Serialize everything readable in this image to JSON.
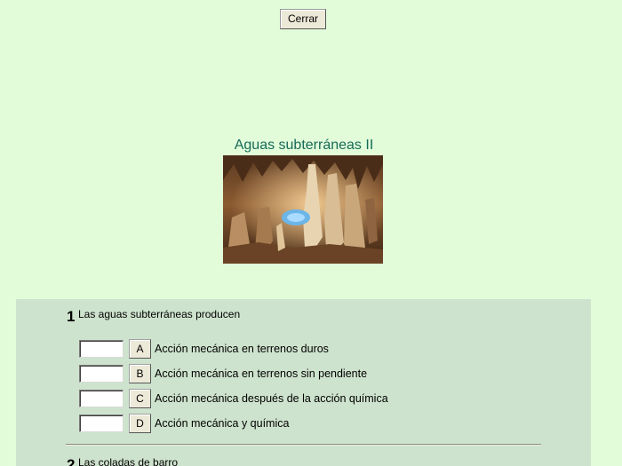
{
  "close_button": {
    "label": "Cerrar"
  },
  "exercise": {
    "title": "Aguas subterráneas II"
  },
  "questions": [
    {
      "number": "1",
      "text": "Las aguas subterráneas producen",
      "options": [
        {
          "letter": "A",
          "text": "Acción mecánica en terrenos duros",
          "answer": ""
        },
        {
          "letter": "B",
          "text": "Acción mecánica en terrenos sin pendiente",
          "answer": ""
        },
        {
          "letter": "C",
          "text": "Acción mecánica después de la acción química",
          "answer": ""
        },
        {
          "letter": "D",
          "text": "Acción mecánica y química",
          "answer": ""
        }
      ]
    },
    {
      "number": "2",
      "text": "Las coladas de barro"
    }
  ],
  "colors": {
    "page_background": "#e2fcda",
    "panel_background": "#cee3cd",
    "title_color": "#166a58"
  }
}
